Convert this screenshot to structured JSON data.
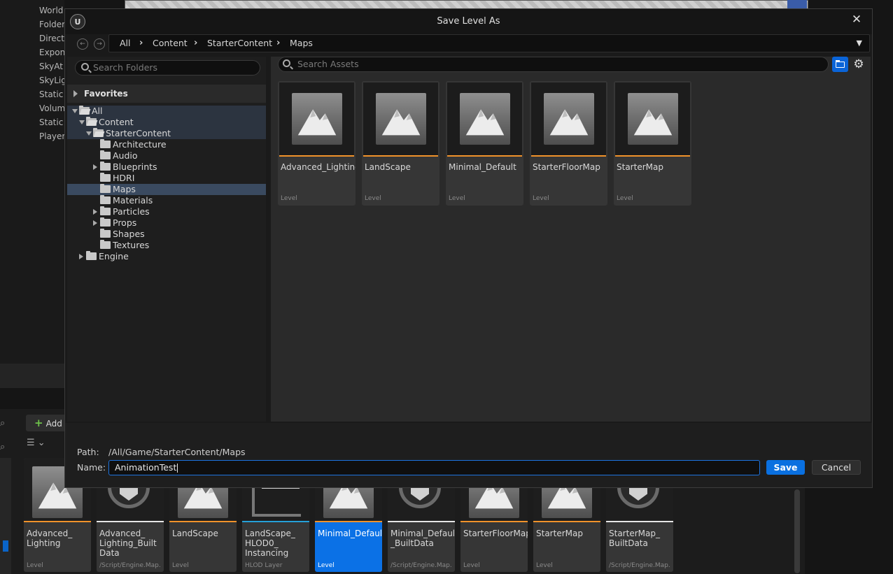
{
  "background": {
    "outliner_items": [
      "World",
      "Folder",
      "Direct",
      "Expon",
      "SkyAt",
      "SkyLig",
      "Static",
      "Volum",
      "Static",
      "Player"
    ],
    "add_button": "Add",
    "content_browser_assets": [
      {
        "name": "Advanced_\nLighting",
        "type": "Level",
        "accent": "#f0922a",
        "selected": false
      },
      {
        "name": "Advanced_\nLighting_Built\nData",
        "type": "/Script/Engine.Map...",
        "accent": "#e6e6e6",
        "selected": false
      },
      {
        "name": "LandScape",
        "type": "Level",
        "accent": "#f0922a",
        "selected": false
      },
      {
        "name": "LandScape_\nHLOD0_\nInstancing",
        "type": "HLOD Layer",
        "accent": "#25a0d8",
        "selected": false
      },
      {
        "name": "Minimal_Default",
        "type": "Level",
        "accent": "#f0922a",
        "selected": true
      },
      {
        "name": "Minimal_Default\n_BuiltData",
        "type": "/Script/Engine.Map...",
        "accent": "#e6e6e6",
        "selected": false
      },
      {
        "name": "StarterFloorMap",
        "type": "Level",
        "accent": "#f0922a",
        "selected": false
      },
      {
        "name": "StarterMap",
        "type": "Level",
        "accent": "#f0922a",
        "selected": false
      },
      {
        "name": "StarterMap_\nBuiltData",
        "type": "/Script/Engine.Map...",
        "accent": "#e6e6e6",
        "selected": false
      }
    ]
  },
  "dialog": {
    "title": "Save Level As",
    "logo_text": "U",
    "close_glyph": "✕",
    "breadcrumbs": [
      "All",
      "Content",
      "StarterContent",
      "Maps"
    ],
    "search_folders_placeholder": "Search Folders",
    "search_assets_placeholder": "Search Assets",
    "favorites_label": "Favorites",
    "tree": [
      {
        "label": "All",
        "depth": 0,
        "expander": "open",
        "folder_open": true,
        "state": "hl"
      },
      {
        "label": "Content",
        "depth": 1,
        "expander": "open",
        "folder_open": true,
        "state": "hl"
      },
      {
        "label": "StarterContent",
        "depth": 2,
        "expander": "open",
        "folder_open": true,
        "state": "hl"
      },
      {
        "label": "Architecture",
        "depth": 3,
        "expander": "none",
        "folder_open": false,
        "state": ""
      },
      {
        "label": "Audio",
        "depth": 3,
        "expander": "none",
        "folder_open": false,
        "state": ""
      },
      {
        "label": "Blueprints",
        "depth": 3,
        "expander": "closed",
        "folder_open": false,
        "state": ""
      },
      {
        "label": "HDRI",
        "depth": 3,
        "expander": "none",
        "folder_open": false,
        "state": ""
      },
      {
        "label": "Maps",
        "depth": 3,
        "expander": "none",
        "folder_open": false,
        "state": "sel"
      },
      {
        "label": "Materials",
        "depth": 3,
        "expander": "none",
        "folder_open": false,
        "state": ""
      },
      {
        "label": "Particles",
        "depth": 3,
        "expander": "closed",
        "folder_open": false,
        "state": ""
      },
      {
        "label": "Props",
        "depth": 3,
        "expander": "closed",
        "folder_open": false,
        "state": ""
      },
      {
        "label": "Shapes",
        "depth": 3,
        "expander": "none",
        "folder_open": false,
        "state": ""
      },
      {
        "label": "Textures",
        "depth": 3,
        "expander": "none",
        "folder_open": false,
        "state": ""
      },
      {
        "label": "Engine",
        "depth": 1,
        "expander": "closed",
        "folder_open": false,
        "state": ""
      }
    ],
    "assets": [
      {
        "name": "Advanced_Lighting",
        "type": "Level"
      },
      {
        "name": "LandScape",
        "type": "Level"
      },
      {
        "name": "Minimal_Default",
        "type": "Level"
      },
      {
        "name": "StarterFloorMap",
        "type": "Level"
      },
      {
        "name": "StarterMap",
        "type": "Level"
      }
    ],
    "path_label": "Path:",
    "path_value": "/All/Game/StarterContent/Maps",
    "name_label": "Name:",
    "name_value": "AnimationTest",
    "save_label": "Save",
    "cancel_label": "Cancel"
  },
  "colors": {
    "accent_blue": "#0a70e0",
    "level_orange": "#f0922a"
  }
}
